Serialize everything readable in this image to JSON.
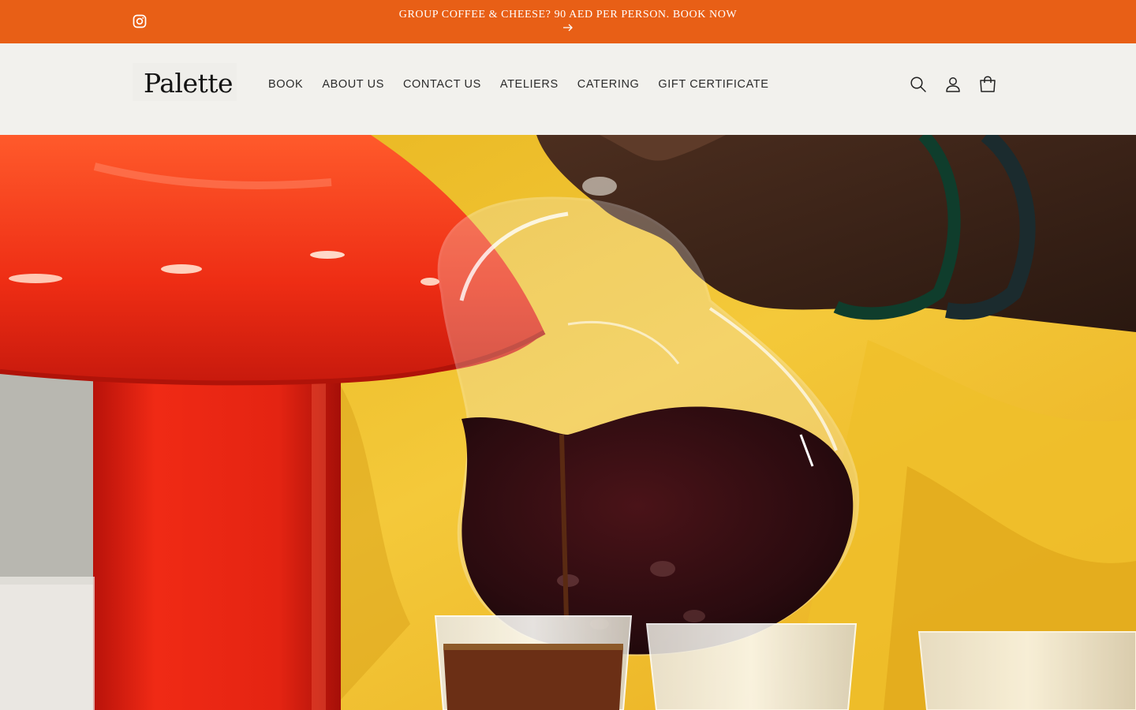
{
  "announcement": {
    "text": "GROUP COFFEE & CHEESE? 90 AED PER PERSON. BOOK NOW",
    "background": "#e85f16",
    "social_icon": "instagram-icon",
    "arrow_icon": "arrow-right-icon"
  },
  "header": {
    "logo_text": "Palette",
    "nav": [
      {
        "label": "BOOK"
      },
      {
        "label": "ABOUT US"
      },
      {
        "label": "CONTACT US"
      },
      {
        "label": "ATELIERS"
      },
      {
        "label": "CATERING"
      },
      {
        "label": "GIFT CERTIFICATE"
      }
    ],
    "icons": [
      "search-icon",
      "account-icon",
      "cart-icon"
    ]
  },
  "hero": {
    "image_subject": "hero-image",
    "colors": {
      "lamp": "#e8321c",
      "sweater": "#f2c21f",
      "coffee": "#2a0d10",
      "skin": "#3a2418"
    }
  }
}
